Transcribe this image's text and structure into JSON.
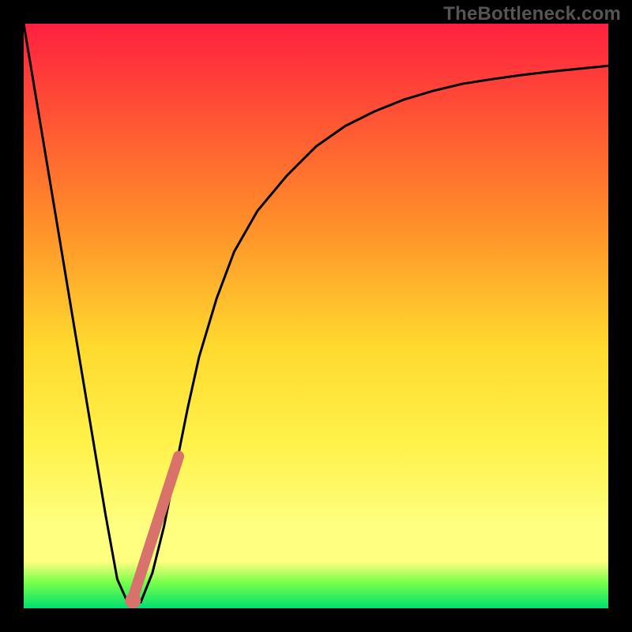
{
  "watermark": "TheBottleneck.com",
  "colors": {
    "frame": "#000000",
    "curve": "#000000",
    "highlight_stroke": "#d9726a",
    "highlight_dot": "#d9726a",
    "gradient_top": "#ff2040",
    "gradient_mid1": "#ff8a2a",
    "gradient_mid2": "#ffd92e",
    "gradient_mid3": "#fff24a",
    "gradient_band": "#ffff80",
    "gradient_green1": "#7aff4a",
    "gradient_green2": "#00e070"
  },
  "chart_data": {
    "type": "line",
    "title": "",
    "xlabel": "",
    "ylabel": "",
    "xlim": [
      0,
      100
    ],
    "ylim": [
      0,
      100
    ],
    "series": [
      {
        "name": "bottleneck-curve",
        "x": [
          0,
          2,
          4,
          6,
          8,
          10,
          12,
          14,
          16,
          18,
          20,
          22,
          24,
          26,
          28,
          30,
          33,
          36,
          40,
          45,
          50,
          55,
          60,
          65,
          70,
          75,
          80,
          85,
          90,
          95,
          100
        ],
        "y": [
          100,
          88,
          76,
          64,
          52,
          40,
          28,
          16,
          5,
          0.5,
          1,
          6,
          14,
          24,
          34,
          43,
          53,
          61,
          68,
          74,
          79,
          82.5,
          85,
          87,
          88.5,
          89.7,
          90.5,
          91.2,
          91.8,
          92.3,
          92.8
        ]
      }
    ],
    "highlight_segment": {
      "x": [
        18.5,
        26.5
      ],
      "y": [
        1.2,
        26
      ]
    },
    "highlight_point": {
      "x": 18.7,
      "y": 1.3
    }
  }
}
